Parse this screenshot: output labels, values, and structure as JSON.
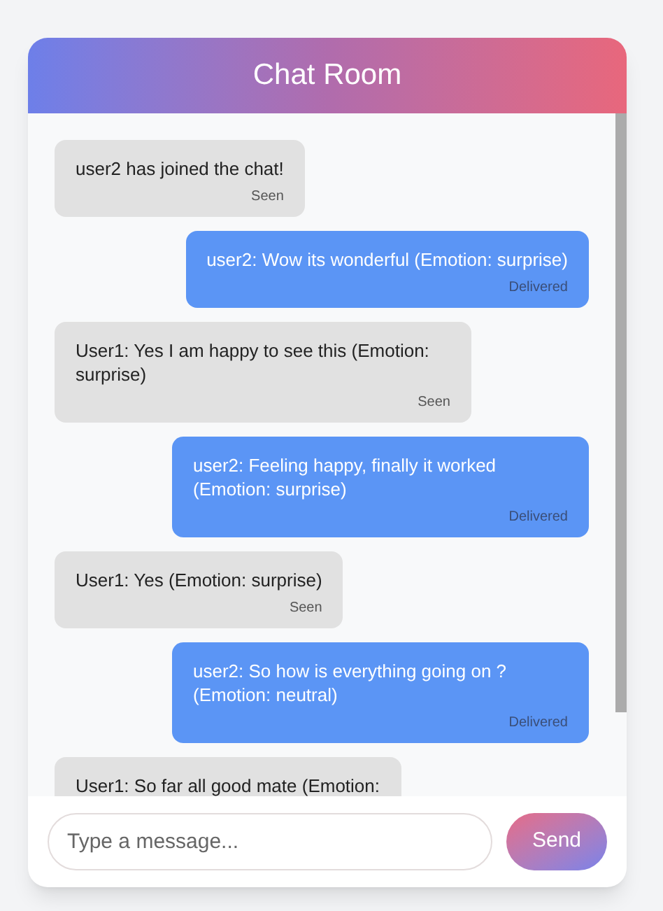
{
  "title": "Chat Room",
  "messages": [
    {
      "kind": "received",
      "text": "user2 has joined the chat!",
      "status": "Seen"
    },
    {
      "kind": "sent",
      "text": "user2: Wow its wonderful (Emotion: surprise)",
      "status": "Delivered"
    },
    {
      "kind": "received",
      "text": "User1: Yes I am happy to see this (Emotion: surprise)",
      "status": "Seen"
    },
    {
      "kind": "sent",
      "text": "user2: Feeling happy, finally it worked (Emotion: surprise)",
      "status": "Delivered"
    },
    {
      "kind": "received",
      "text": "User1: Yes (Emotion: surprise)",
      "status": "Seen"
    },
    {
      "kind": "sent",
      "text": "user2: So how is everything going on ? (Emotion: neutral)",
      "status": "Delivered"
    },
    {
      "kind": "received",
      "text": "User1: So far all good mate (Emotion:"
    }
  ],
  "composer": {
    "placeholder": "Type a message...",
    "button": "Send"
  }
}
